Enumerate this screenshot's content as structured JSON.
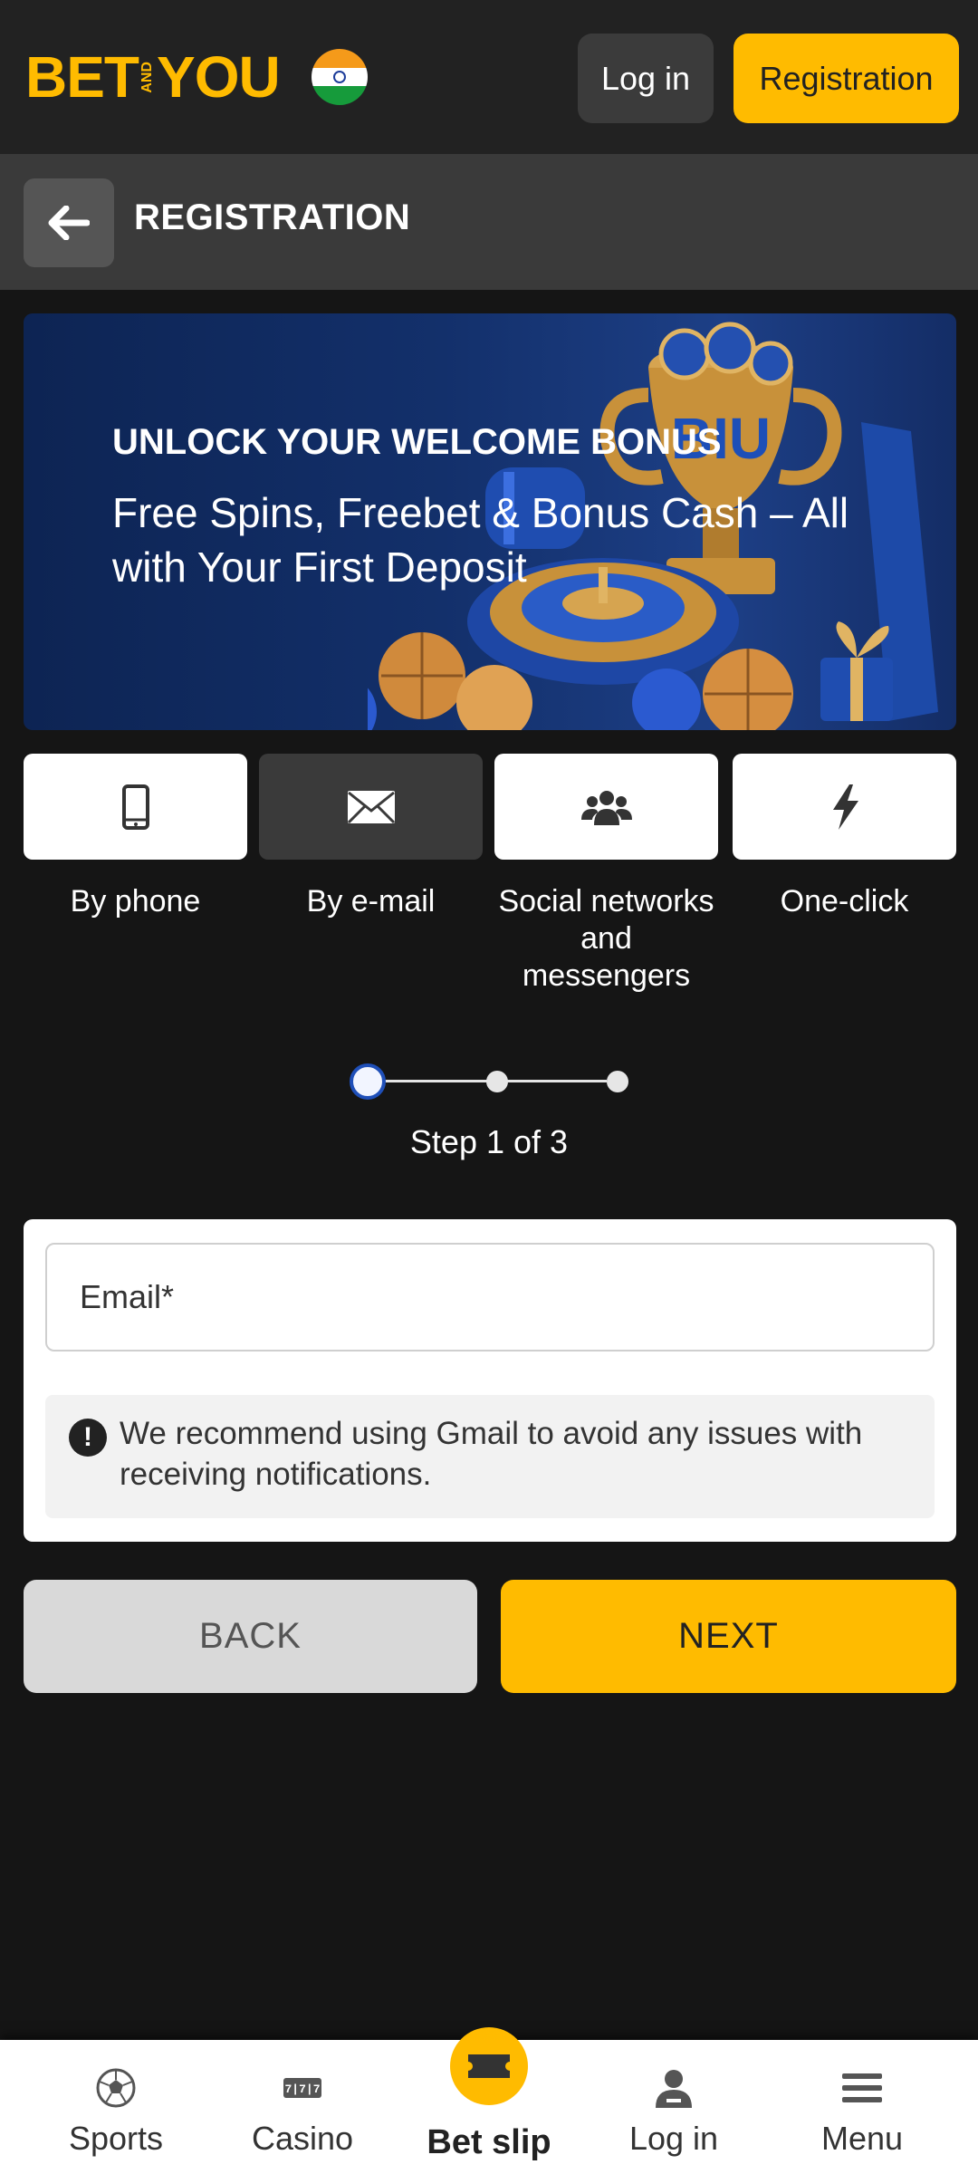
{
  "header": {
    "logo": {
      "left": "BET",
      "middle": "AND",
      "right": "YOU"
    },
    "flag_icon": "india-flag-icon",
    "login_label": "Log in",
    "registration_label": "Registration"
  },
  "subheader": {
    "back_icon": "arrow-left-icon",
    "title": "REGISTRATION"
  },
  "banner": {
    "title": "UNLOCK YOUR WELCOME BONUS",
    "subtitle": "Free Spins, Freebet & Bonus Cash – All with Your First Deposit"
  },
  "methods": [
    {
      "label": "By phone",
      "icon": "phone-icon",
      "active": false
    },
    {
      "label": "By e-mail",
      "icon": "envelope-icon",
      "active": true
    },
    {
      "label": "Social networks and messengers",
      "icon": "users-icon",
      "active": false
    },
    {
      "label": "One-click",
      "icon": "lightning-icon",
      "active": false
    }
  ],
  "steps": {
    "current": 1,
    "total": 3,
    "text": "Step 1 of 3"
  },
  "form": {
    "email_placeholder": "Email*",
    "email_value": "",
    "notice_icon": "exclamation-icon",
    "notice_text": "We recommend using Gmail to avoid any issues with receiving notifications."
  },
  "actions": {
    "back_label": "BACK",
    "next_label": "NEXT"
  },
  "bottom_nav": {
    "sports": "Sports",
    "casino": "Casino",
    "bet_slip": "Bet slip",
    "login": "Log in",
    "menu": "Menu"
  },
  "colors": {
    "accent": "#ffbb00",
    "background": "#151515",
    "header": "#222222",
    "subheader": "#3a3a3a",
    "step_active": "#1f4fb8"
  }
}
